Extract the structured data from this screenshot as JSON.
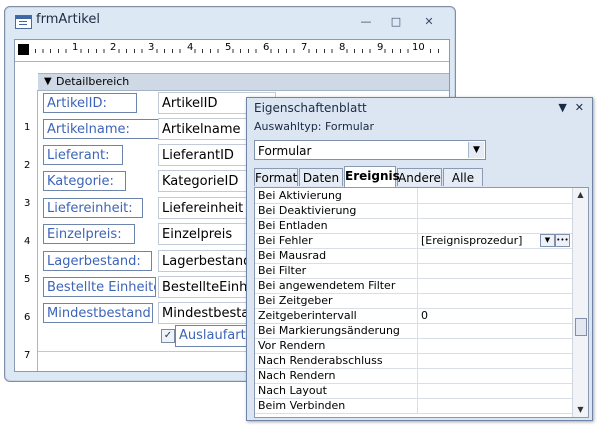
{
  "form_window": {
    "title": "frmArtikel",
    "section_title": "Detailbereich",
    "ruler_numbers": [
      "1",
      "2",
      "3",
      "4",
      "5",
      "6",
      "7",
      "8",
      "9",
      "10"
    ],
    "vruler_numbers": [
      "1",
      "2",
      "3",
      "4",
      "5",
      "6",
      "7"
    ],
    "fields": [
      {
        "label": "ArtikelID:",
        "value": "ArtikelID"
      },
      {
        "label": "Artikelname:",
        "value": "Artikelname"
      },
      {
        "label": "Lieferant:",
        "value": "LieferantID"
      },
      {
        "label": "Kategorie:",
        "value": "KategorieID"
      },
      {
        "label": "Liefereinheit:",
        "value": "Liefereinheit"
      },
      {
        "label": "Einzelpreis:",
        "value": "Einzelpreis"
      },
      {
        "label": "Lagerbestand:",
        "value": "Lagerbestand"
      },
      {
        "label": "Bestellte Einheiten:",
        "value": "BestellteEinheiten"
      },
      {
        "label": "Mindestbestand:",
        "value": "Mindestbestand"
      }
    ],
    "checkbox_label": "Auslaufartikel"
  },
  "property_sheet": {
    "title": "Eigenschaftenblatt",
    "selection_type": "Auswahltyp:  Formular",
    "combo_value": "Formular",
    "tabs": [
      "Format",
      "Daten",
      "Ereignis",
      "Andere",
      "Alle"
    ],
    "active_tab": "Ereignis",
    "rows": [
      {
        "name": "Bei Aktivierung",
        "value": ""
      },
      {
        "name": "Bei Deaktivierung",
        "value": ""
      },
      {
        "name": "Bei Entladen",
        "value": ""
      },
      {
        "name": "Bei Fehler",
        "value": "[Ereignisprozedur]"
      },
      {
        "name": "Bei Mausrad",
        "value": ""
      },
      {
        "name": "Bei Filter",
        "value": ""
      },
      {
        "name": "Bei angewendetem Filter",
        "value": ""
      },
      {
        "name": "Bei Zeitgeber",
        "value": ""
      },
      {
        "name": "Zeitgeberintervall",
        "value": "0"
      },
      {
        "name": "Bei Markierungsänderung",
        "value": ""
      },
      {
        "name": "Vor Rendern",
        "value": ""
      },
      {
        "name": "Nach Renderabschluss",
        "value": ""
      },
      {
        "name": "Nach Rendern",
        "value": ""
      },
      {
        "name": "Nach Layout",
        "value": ""
      },
      {
        "name": "Beim Verbinden",
        "value": ""
      }
    ]
  }
}
